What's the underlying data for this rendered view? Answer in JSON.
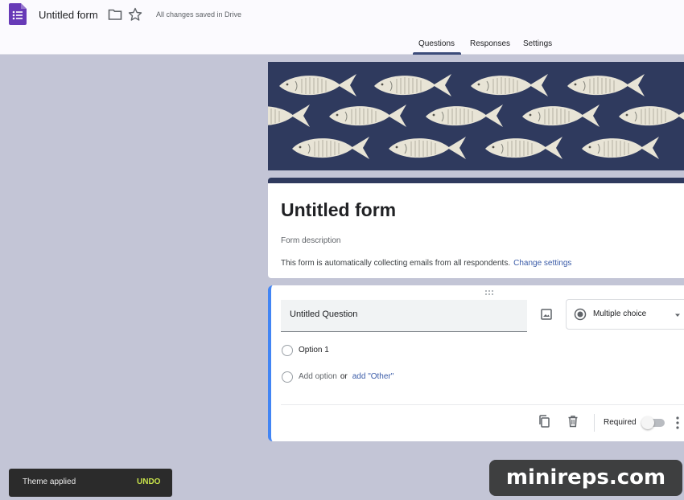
{
  "header": {
    "title": "Untitled form",
    "save_status": "All changes saved in Drive",
    "tabs": [
      "Questions",
      "Responses",
      "Settings"
    ],
    "active_tab": "Questions"
  },
  "icons": {
    "app": "google-forms-icon",
    "folder": "folder-icon",
    "star": "star-icon",
    "image": "image-icon",
    "copy": "copy-icon",
    "delete": "trash-icon",
    "more": "more-vert-icon"
  },
  "form": {
    "title": "Untitled form",
    "description_placeholder": "Form description",
    "email_notice": "This form is automatically collecting emails from all respondents.",
    "change_settings": "Change settings"
  },
  "question": {
    "title": "Untitled Question",
    "type": "Multiple choice",
    "options": [
      "Option 1"
    ],
    "add_option": "Add option",
    "or": "or",
    "add_other": "add \"Other\"",
    "required_label": "Required"
  },
  "snackbar": {
    "message": "Theme applied",
    "action": "UNDO"
  },
  "watermark": "minireps.com",
  "colors": {
    "accent": "#4285f4",
    "theme_header": "#2f3a5e",
    "background": "#c3c5d6",
    "link": "#3b5ca8",
    "undo": "#c6e04a"
  }
}
